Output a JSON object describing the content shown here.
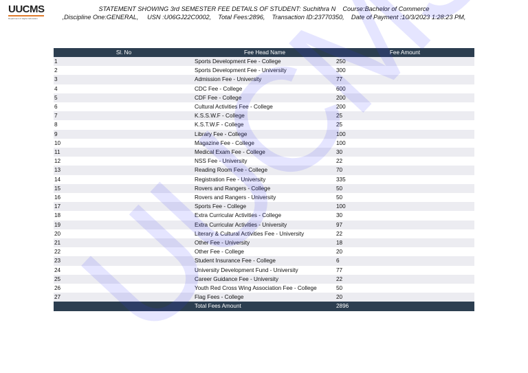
{
  "logo": {
    "text": "UUCMS",
    "subtitle": "Department of Higher Education"
  },
  "header": {
    "line1": "STATEMENT SHOWING 3rd SEMESTER FEE DETAILS OF STUDENT: Suchithra N    Course:Bachelor of Commerce",
    "line2": ",Discipline One:GENERAL,     USN :U06GJ22C0002,    Total Fees:2896,    Transaction ID:23770350,    Date of Payment :10/3/2023 1:28:23 PM,"
  },
  "table": {
    "columns": [
      "Sl. No",
      "Fee Head Name",
      "Fee Amount"
    ],
    "rows": [
      [
        "1",
        "Sports Development Fee - College",
        "250"
      ],
      [
        "2",
        "Sports Development Fee - University",
        "300"
      ],
      [
        "3",
        "Admission Fee - University",
        "77"
      ],
      [
        "4",
        "CDC Fee - College",
        "600"
      ],
      [
        "5",
        "CDF Fee - College",
        "200"
      ],
      [
        "6",
        "Cultural Activities Fee - College",
        "200"
      ],
      [
        "7",
        "K.S.S.W.F - College",
        "25"
      ],
      [
        "8",
        "K.S.T.W.F - College",
        "25"
      ],
      [
        "9",
        "Library Fee - College",
        "100"
      ],
      [
        "10",
        "Magazine Fee - College",
        "100"
      ],
      [
        "11",
        "Medical Exam Fee - College",
        "30"
      ],
      [
        "12",
        "NSS Fee - University",
        "22"
      ],
      [
        "13",
        "Reading Room Fee - College",
        "70"
      ],
      [
        "14",
        "Registration Fee - University",
        "335"
      ],
      [
        "15",
        "Rovers and Rangers - College",
        "50"
      ],
      [
        "16",
        "Rovers and Rangers - University",
        "50"
      ],
      [
        "17",
        "Sports Fee - College",
        "100"
      ],
      [
        "18",
        "Extra Curricular Activities - College",
        "30"
      ],
      [
        "19",
        "Extra Curricular Activities - University",
        "97"
      ],
      [
        "20",
        "Literary & Cultural Activities Fee - University",
        "22"
      ],
      [
        "21",
        "Other Fee - University",
        "18"
      ],
      [
        "22",
        "Other Fee - College",
        "20"
      ],
      [
        "23",
        "Student Insurance Fee - College",
        "6"
      ],
      [
        "24",
        "University Development Fund - University",
        "77"
      ],
      [
        "25",
        "Career Guidance Fee - University",
        "22"
      ],
      [
        "26",
        "Youth Red Cross Wing Association Fee - College",
        "50"
      ],
      [
        "27",
        "Flag Fees - College",
        "20"
      ]
    ],
    "total_label": "Total Fees Amount",
    "total_amount": "2896"
  },
  "watermark": "UUCMS"
}
